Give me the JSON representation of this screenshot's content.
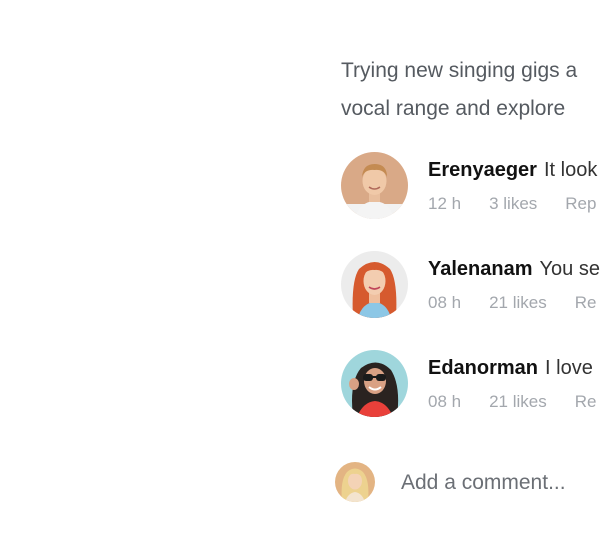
{
  "post": {
    "caption_line1": "Trying new singing gigs a",
    "caption_line2": "vocal range and explore"
  },
  "comments": [
    {
      "user": "Erenyaeger",
      "text": "It look",
      "time": "12 h",
      "likes": "3 likes",
      "reply": "Rep"
    },
    {
      "user": "Yalenanam",
      "text": "You se",
      "time": "08 h",
      "likes": "21 likes",
      "reply": "Re"
    },
    {
      "user": "Edanorman",
      "text": "I love",
      "time": "08 h",
      "likes": "21 likes",
      "reply": "Re"
    }
  ],
  "add_comment": {
    "placeholder": "Add a comment..."
  },
  "colors": {
    "meta_text": "#a3a7ad",
    "caption_text": "#555a60",
    "username": "#111111"
  }
}
